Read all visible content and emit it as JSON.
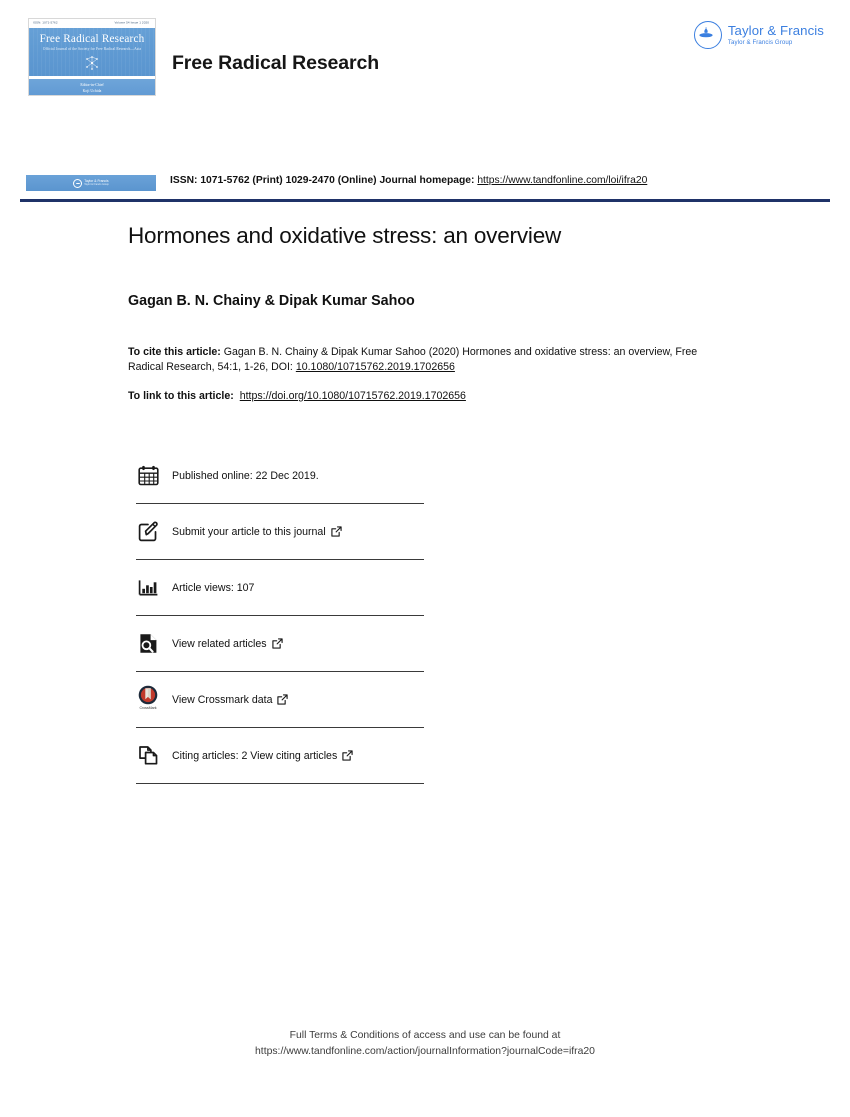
{
  "masthead": {
    "journal_name": "Free Radical Research",
    "cover": {
      "top_left": "ISSN: 1071-5762",
      "top_right": "Volume 54   Issue 1   2020",
      "title": "Free Radical Research",
      "subtitle": "Official Journal of the Society for Free Radical Research—Asia",
      "editor_line": "Editor-in-Chief",
      "editor_name": "Koji Uchida"
    },
    "publisher": {
      "name": "Taylor & Francis",
      "group": "Taylor & Francis Group",
      "brand_color": "#3b7fe0"
    }
  },
  "issn_band": {
    "badge": {
      "line1": "Taylor & Francis",
      "line2": "Taylor & Francis Group"
    },
    "prefix": "ISSN: 1071-5762 (Print) 1029-2470 (Online) Journal homepage:",
    "homepage_url": "https://www.tandfonline.com/loi/ifra20",
    "rule_color": "#1f3268"
  },
  "article": {
    "title": "Hormones and oxidative stress: an overview",
    "authors": "Gagan B. N. Chainy & Dipak Kumar Sahoo",
    "cite_label": "To cite this article:",
    "cite_text": "Gagan B. N. Chainy & Dipak Kumar Sahoo (2020) Hormones and oxidative stress: an overview, Free Radical Research, 54:1, 1-26, DOI:",
    "cite_doi": "10.1080/10715762.2019.1702656",
    "link_label": "To link to this article:",
    "link_url": "https://doi.org/10.1080/10715762.2019.1702656"
  },
  "metadata": {
    "rows": [
      {
        "icon": "calendar-icon",
        "label": "Published online: 22 Dec 2019.",
        "external": false
      },
      {
        "icon": "edit-pencil-icon",
        "label": "Submit your article to this journal",
        "external": true
      },
      {
        "icon": "bar-chart-icon",
        "label": "Article views: 107",
        "external": false
      },
      {
        "icon": "document-search-icon",
        "label": "View related articles",
        "external": true
      },
      {
        "icon": "crossmark-icon",
        "label": "View Crossmark data",
        "external": true,
        "icon_caption": "CrossMark"
      },
      {
        "icon": "copy-pages-icon",
        "label": "Citing articles: 2 View citing articles",
        "external": true
      }
    ]
  },
  "footer": {
    "line1": "Full Terms & Conditions of access and use can be found at",
    "line2": "https://www.tandfonline.com/action/journalInformation?journalCode=ifra20"
  }
}
